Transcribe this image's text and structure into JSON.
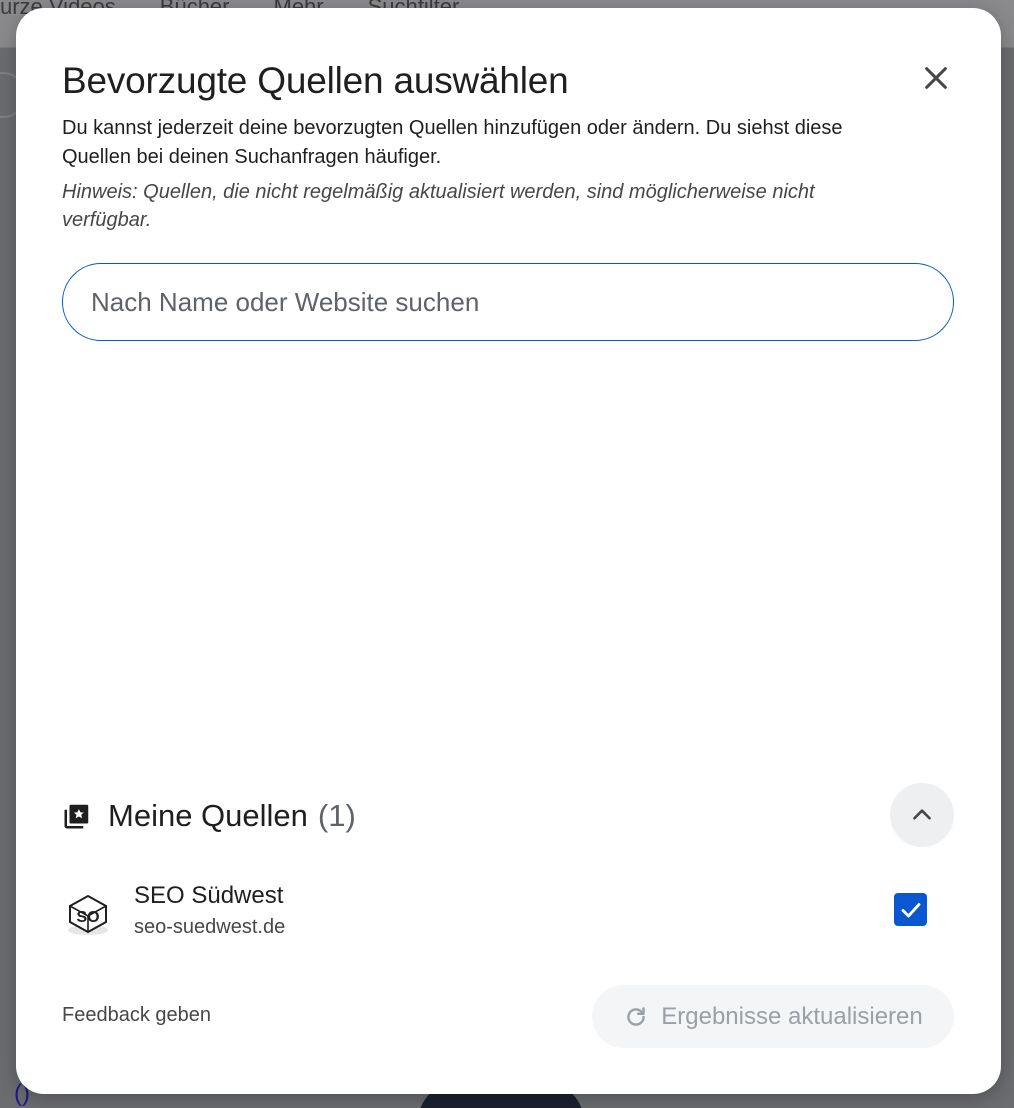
{
  "background": {
    "tabs": [
      "urze Videos",
      "Bücher",
      "Mehr",
      "Suchfilter"
    ],
    "link_text": "()"
  },
  "dialog": {
    "title": "Bevorzugte Quellen auswählen",
    "close_icon": "close-icon",
    "subtitle": "Du kannst jederzeit deine bevorzugten Quellen hinzufügen oder ändern. Du siehst diese Quellen bei deinen Suchanfragen häufiger.",
    "hint": "Hinweis: Quellen, die nicht regelmäßig aktualisiert werden, sind möglicherweise nicht verfügbar.",
    "search": {
      "placeholder": "Nach Name oder Website suchen",
      "value": ""
    },
    "my_sources": {
      "label": "Meine Quellen",
      "count": "(1)",
      "icon": "starred-collection-icon",
      "expanded": true,
      "items": [
        {
          "name": "SEO Südwest",
          "url": "seo-suedwest.de",
          "logo_text": "SO",
          "checked": true
        }
      ]
    },
    "footer": {
      "feedback_label": "Feedback geben",
      "refresh_label": "Ergebnisse aktualisieren",
      "refresh_icon": "refresh-icon",
      "refresh_enabled": false
    }
  },
  "colors": {
    "accent": "#0b57d0",
    "overlay": "#5f6063",
    "text_primary": "#1f1f1f",
    "text_secondary": "#474747",
    "disabled_text": "#9aa0a6"
  }
}
